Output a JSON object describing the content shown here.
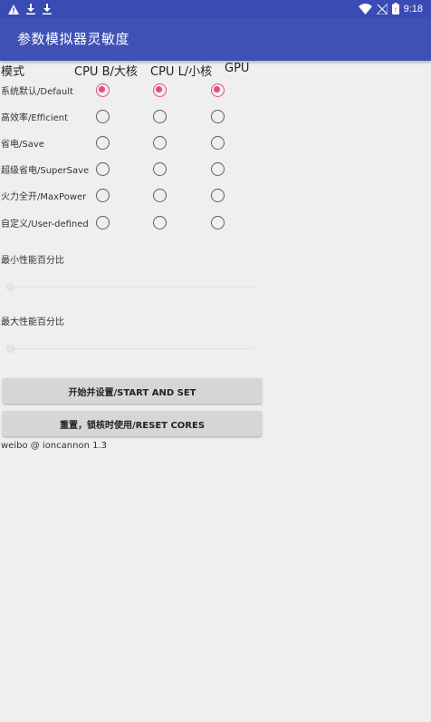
{
  "status_bar": {
    "time": "9:18",
    "left_icons": [
      "warning-icon",
      "download-icon",
      "download-icon"
    ],
    "right_icons": [
      "wifi-icon",
      "no-signal-icon",
      "battery-icon"
    ]
  },
  "app_bar": {
    "title": "参数模拟器灵敏度"
  },
  "table": {
    "headers": {
      "mode": "模式",
      "cpu_big": "CPU B/大核",
      "cpu_little": "CPU L/小核",
      "gpu": "GPU"
    },
    "rows": [
      {
        "label": "系统默认/Default",
        "cpu_big": true,
        "cpu_little": true,
        "gpu": true
      },
      {
        "label": "高效率/Efficient",
        "cpu_big": false,
        "cpu_little": false,
        "gpu": false
      },
      {
        "label": "省电/Save",
        "cpu_big": false,
        "cpu_little": false,
        "gpu": false
      },
      {
        "label": "超级省电/SuperSave",
        "cpu_big": false,
        "cpu_little": false,
        "gpu": false
      },
      {
        "label": "火力全开/MaxPower",
        "cpu_big": false,
        "cpu_little": false,
        "gpu": false
      },
      {
        "label": "自定义/User-defined",
        "cpu_big": false,
        "cpu_little": false,
        "gpu": false
      }
    ]
  },
  "sliders": {
    "min_label": "最小性能百分比",
    "min_value": 0,
    "max_label": "最大性能百分比",
    "max_value": 0
  },
  "buttons": {
    "start": "开始并设置/START AND SET",
    "reset": "重置，锁核时使用/RESET CORES"
  },
  "footer": "weibo @ ioncannon 1.3",
  "colors": {
    "app_bar": "#3f51b5",
    "status_bar": "#3a4bb3",
    "accent": "#e84c7d",
    "background": "#efefef"
  }
}
